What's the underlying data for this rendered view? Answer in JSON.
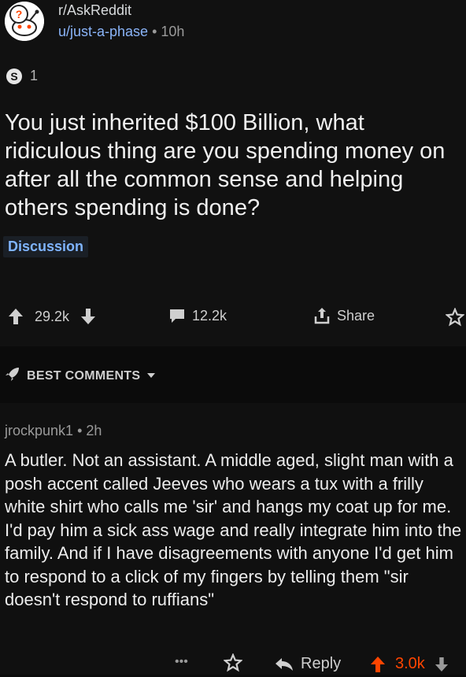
{
  "post": {
    "subreddit": "r/AskReddit",
    "author": "u/just-a-phase",
    "time": "• 10h",
    "award_count": "1",
    "award_symbol": "S",
    "title": "You just inherited $100 Billion, what ridiculous thing are you spending money on after all the common sense and helping others spending is done?",
    "flair": "Discussion",
    "upvotes": "29.2k",
    "comments": "12.2k",
    "share_label": "Share"
  },
  "comments_header": {
    "label": "BEST COMMENTS"
  },
  "top_comment": {
    "author": "jrockpunk1",
    "time": "• 2h",
    "body": "A butler. Not an assistant. A middle aged, slight man with a posh accent called Jeeves who wears a tux with a frilly white shirt who calls me 'sir' and hangs my coat up for me. I'd pay him a sick ass wage and really integrate him into the family. And if I have disagreements with anyone I'd get him to respond to a click of my fingers by telling them \"sir doesn't respond to ruffians\"",
    "more_label": "•••",
    "reply_label": "Reply",
    "score": "3.0k"
  },
  "colors": {
    "upvote_accent": "#ff4500",
    "link_blue": "#8ab4f8",
    "flair_text": "#7fb4ff"
  }
}
